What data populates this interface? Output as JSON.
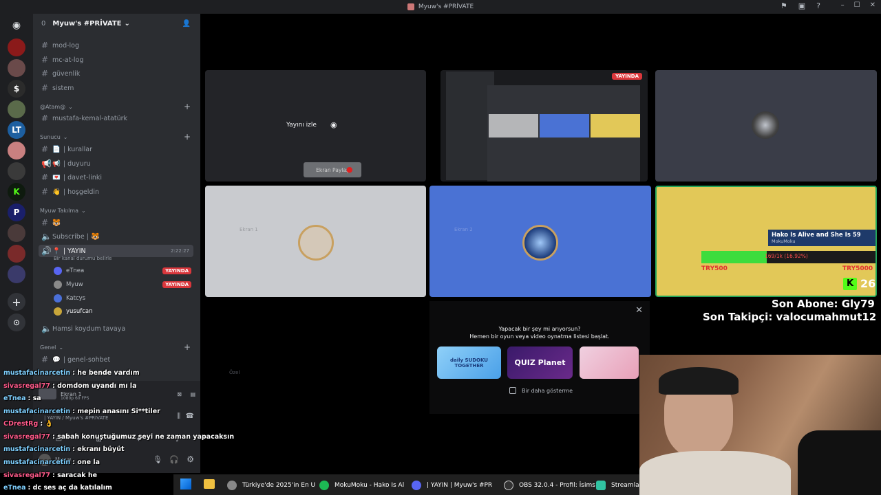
{
  "window": {
    "title": "Myuw's #PRİVATE"
  },
  "guild": {
    "badge": "0",
    "name": "Myuw's #PRİVATE"
  },
  "channels_top": [
    "mod-log",
    "mc-at-log",
    "güvenlik",
    "sistem"
  ],
  "category_atam": {
    "label": "@Atam@"
  },
  "channel_ataturk": "mustafa-kemal-atatürk",
  "category_sunucu": {
    "label": "Sunucu"
  },
  "sunucu_channels": [
    "| kurallar",
    "| duyuru",
    "| davet-linki",
    "| hoşgeldin"
  ],
  "category_myuw": {
    "label": "Myuw Takılma"
  },
  "subscribe_label": "Subscribe |",
  "voice_channel": {
    "name": "| YAYIN",
    "status": "Bir kanal durumu belirle",
    "timer": "2:22:27"
  },
  "voice_users": [
    {
      "name": "eTnea",
      "live": "YAYINDA",
      "color": "#5865f2"
    },
    {
      "name": "Myuw",
      "live": "YAYINDA",
      "color": "#8a8a8a"
    },
    {
      "name": "Katcys",
      "live": "",
      "color": "#4a6fd8"
    },
    {
      "name": "yusufcan",
      "live": "",
      "color": "#c8a63a"
    }
  ],
  "hamsi_channel": "Hamsi koydum tavaya",
  "category_genel": {
    "label": "Genel"
  },
  "genel_channel": "| genel-sohbet",
  "tiles": {
    "watch_label": "Yayını izle",
    "live_badge": "YAYINDA",
    "ekran1_label": "Ekran 1",
    "ekran2_label": "Ekran 2",
    "ekran_paylas_label": "Ekran Paylaş",
    "ozel_label": "Özel"
  },
  "stream_overlay": {
    "song_title": "Hako Is Alive and She Is 59",
    "song_artist": "MokuMoku",
    "progress_text": "169/1k (16.92%)",
    "progress_fraction": 0.17,
    "left_amount": "TRY500",
    "right_amount": "TRY5000",
    "kick_count": "26",
    "last_sub": "Son Abone: Gly79",
    "last_follower": "Son Takipçi: valocumahmut12"
  },
  "activity": {
    "line1": "Yapacak bir şey mi arıyorsun?",
    "line2": "Hemen bir oyun veya video oynatma listesi başlat.",
    "games": [
      "daily SUDOKU TOGETHER",
      "QUIZ Planet",
      ""
    ],
    "checkbox_label": "Bir daha gösterme"
  },
  "voice_panel": {
    "stream_label": "Ekran 1",
    "stream_sub": "1080p 60 FPS",
    "connected_label": "| YAYIN / Myuw's #PRİVATE",
    "user_name": "Myuw"
  },
  "chat": [
    {
      "user": "mustafacinarcetin",
      "text": ": he bende vardım",
      "color": "#7fd0ff"
    },
    {
      "user": "sivasregal77",
      "text": ": domdom uyandı mı la",
      "color": "#ff5a8a"
    },
    {
      "user": "eTnea",
      "text": ": sa",
      "color": "#7fd0ff"
    },
    {
      "user": "mustafacinarcetin",
      "text": ": mepin anasını Si**tiler",
      "color": "#7fd0ff"
    },
    {
      "user": "CDrestRg",
      "text": ": 👌",
      "color": "#ff5a8a"
    },
    {
      "user": "sivasregal77",
      "text": ": sabah konuştuğumuz şeyi ne zaman yapacaksın",
      "color": "#ff5a8a"
    },
    {
      "user": "mustafacinarcetin",
      "text": ": ekranı büyüt",
      "color": "#7fd0ff"
    },
    {
      "user": "mustafacinarcetin",
      "text": ": one la",
      "color": "#7fd0ff"
    },
    {
      "user": "sivasregal77",
      "text": ": saracak he",
      "color": "#ff5a8a"
    },
    {
      "user": "eTnea",
      "text": ": dc ses aç da katılalım",
      "color": "#7fd0ff"
    }
  ],
  "taskbar": {
    "items": [
      "Türkiye'de 2025'in En U",
      "MokuMoku - Hako Is Al",
      "| YAYIN | Myuw's #PR",
      "OBS 32.0.4 - Profil: İsims",
      "Streamla"
    ]
  }
}
